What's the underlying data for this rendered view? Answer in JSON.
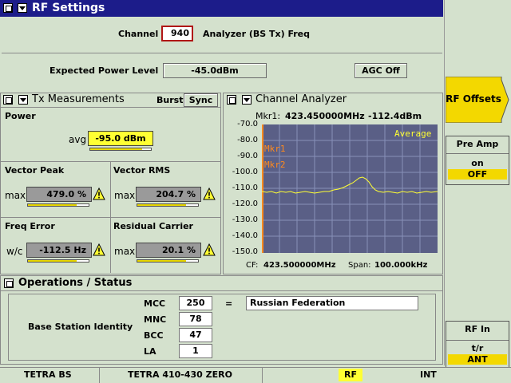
{
  "header": {
    "title": "RF Settings"
  },
  "channel": {
    "label": "Channel",
    "value": "940",
    "mode": "Analyzer (BS Tx) Freq"
  },
  "power_level": {
    "label": "Expected Power Level",
    "value": "-45.0dBm",
    "agc_label": "AGC Off"
  },
  "tx": {
    "title": "Tx Measurements",
    "burst_label": "Burst",
    "sync_label": "Sync",
    "power": {
      "title": "Power",
      "prefix": "avg",
      "value": "-95.0 dBm",
      "level": 0.85
    },
    "vector_peak": {
      "title": "Vector Peak",
      "prefix": "max",
      "value": "479.0 %",
      "level": 0.8
    },
    "vector_rms": {
      "title": "Vector RMS",
      "prefix": "max",
      "value": "204.7 %",
      "level": 0.8
    },
    "freq_error": {
      "title": "Freq Error",
      "prefix": "w/c",
      "value": "-112.5 Hz",
      "level": 0.8
    },
    "residual_carrier": {
      "title": "Residual Carrier",
      "prefix": "max",
      "value": "20.1 %",
      "level": 0.8
    }
  },
  "analyzer": {
    "title": "Channel Analyzer",
    "marker_label": "Mkr1:",
    "marker_freq": "423.450000MHz",
    "marker_level": "-112.4dBm",
    "average_label": "Average",
    "mkr1_label": "Mkr1",
    "mkr2_label": "Mkr2",
    "y_ticks": [
      "-70.0",
      "-80.0",
      "-90.0",
      "-100.0",
      "-110.0",
      "-120.0",
      "-130.0",
      "-140.0",
      "-150.0"
    ],
    "cf_label": "CF:",
    "cf_value": "423.500000MHz",
    "span_label": "Span:",
    "span_value": "100.000kHz"
  },
  "operations": {
    "title": "Operations / Status",
    "bsi_label": "Base Station Identity",
    "mcc_label": "MCC",
    "mcc_value": "250",
    "equals": "=",
    "country": "Russian Federation",
    "mnc_label": "MNC",
    "mnc_value": "78",
    "bcc_label": "BCC",
    "bcc_value": "47",
    "la_label": "LA",
    "la_value": "1"
  },
  "softkeys": {
    "rf_offsets": "RF Offsets",
    "preamp_title": "Pre Amp",
    "preamp_on": "on",
    "preamp_off": "OFF",
    "rfin_title": "RF In",
    "rfin_tr": "t/r",
    "rfin_ant": "ANT"
  },
  "statusbar": {
    "system": "TETRA BS",
    "band": "TETRA 410-430 ZERO",
    "rf": "RF",
    "ref": "INT"
  },
  "colors": {
    "background": "#d4e1cd",
    "title_bar": "#1c1c8a",
    "graph_bg": "#5a5f86",
    "trace": "#ffff33",
    "marker": "#ff8a1e",
    "highlight": "#ffff33"
  }
}
